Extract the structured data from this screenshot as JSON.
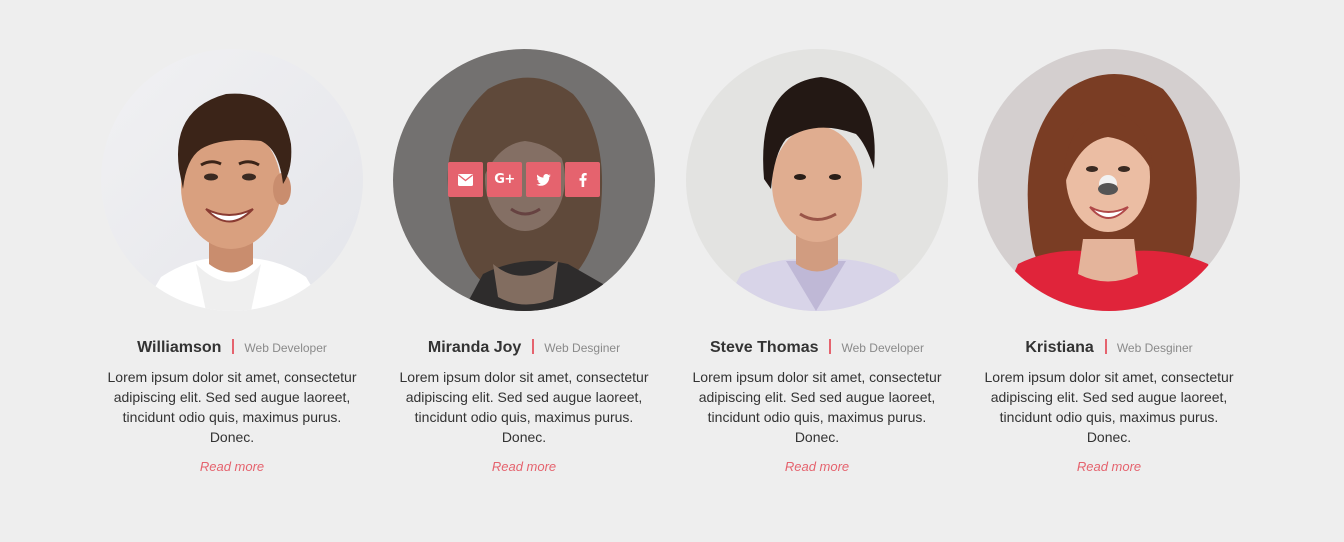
{
  "accent_color": "#e5636e",
  "members": [
    {
      "name": "Williamson",
      "role": "Web Developer",
      "description": "Lorem ipsum dolor sit amet, consectetur adipiscing elit. Sed sed augue laoreet, tincidunt odio quis, maximus purus. Donec.",
      "read_more": "Read more",
      "photo": "man-smiling-white-shirt-photo"
    },
    {
      "name": "Miranda Joy",
      "role": "Web Desginer",
      "description": "Lorem ipsum dolor sit amet, consectetur adipiscing elit. Sed sed augue laoreet, tincidunt odio quis, maximus purus. Donec.",
      "read_more": "Read more",
      "photo": "woman-curly-hair-black-top-photo",
      "hovered": true,
      "social": [
        "envelope-icon",
        "google-plus-icon",
        "twitter-icon",
        "facebook-icon"
      ]
    },
    {
      "name": "Steve Thomas",
      "role": "Web Developer",
      "description": "Lorem ipsum dolor sit amet, consectetur adipiscing elit. Sed sed augue laoreet, tincidunt odio quis, maximus purus. Donec.",
      "read_more": "Read more",
      "photo": "man-dark-hair-lavender-shirt-photo"
    },
    {
      "name": "Kristiana",
      "role": "Web Desginer",
      "description": "Lorem ipsum dolor sit amet, consectetur adipiscing elit. Sed sed augue laoreet, tincidunt odio quis, maximus purus. Donec.",
      "read_more": "Read more",
      "photo": "woman-auburn-hair-red-top-photo"
    }
  ]
}
